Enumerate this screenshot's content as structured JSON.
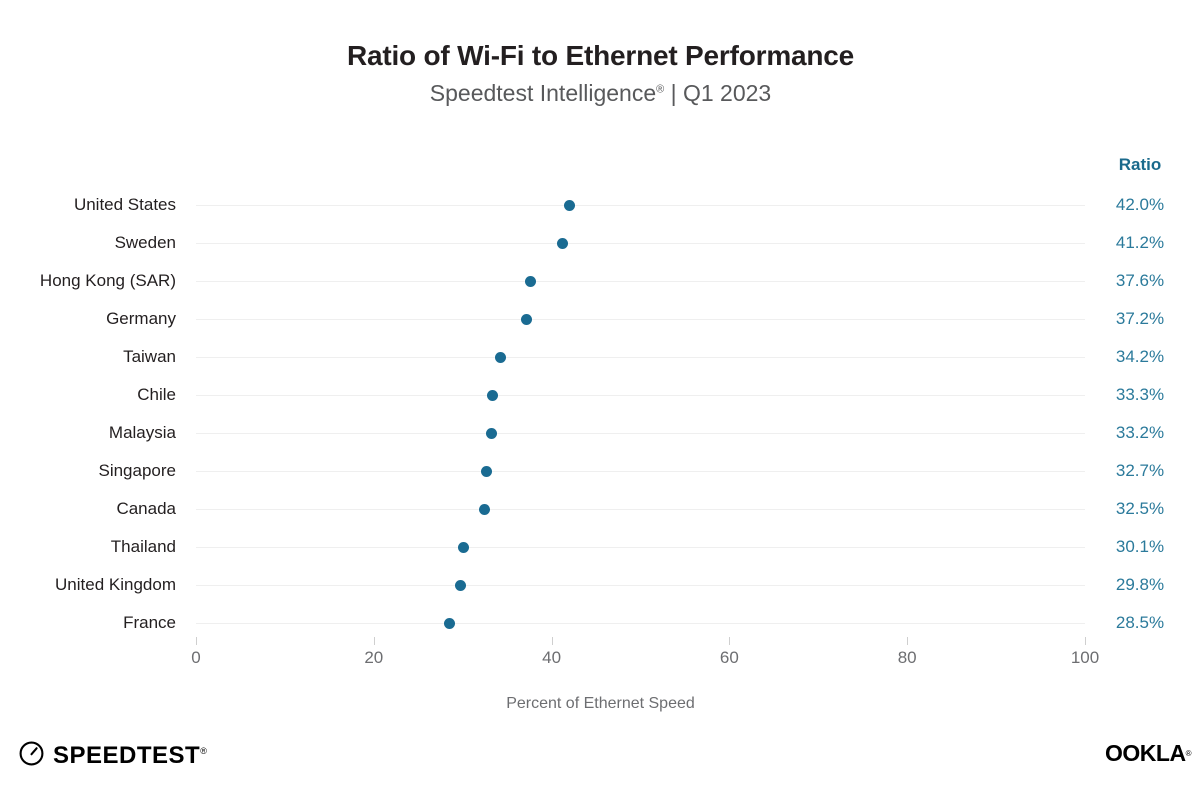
{
  "chart_data": {
    "type": "scatter",
    "title": "Ratio of Wi-Fi to Ethernet Performance",
    "subtitle_main": "Speedtest Intelligence",
    "subtitle_reg": "®",
    "subtitle_tail": " | Q1 2023",
    "xlabel": "Percent of Ethernet Speed",
    "ylabel": "",
    "xlim": [
      0,
      100
    ],
    "xticks": [
      0,
      20,
      40,
      60,
      80,
      100
    ],
    "xtick_labels": [
      "0",
      "20",
      "40",
      "60",
      "80",
      "100"
    ],
    "grid": true,
    "grid_axis": "y",
    "legend": false,
    "value_column_header": "Ratio",
    "dot_color": "#1a6b92",
    "value_text_color": "#2b7a9b",
    "gridline_color": "#efefef",
    "categories": [
      "United States",
      "Sweden",
      "Hong Kong (SAR)",
      "Germany",
      "Taiwan",
      "Chile",
      "Malaysia",
      "Singapore",
      "Canada",
      "Thailand",
      "United Kingdom",
      "France"
    ],
    "values": [
      42.0,
      41.2,
      37.6,
      37.2,
      34.2,
      33.3,
      33.2,
      32.7,
      32.5,
      30.1,
      29.8,
      28.5
    ],
    "value_labels": [
      "42.0%",
      "41.2%",
      "37.6%",
      "37.2%",
      "34.2%",
      "33.3%",
      "33.2%",
      "32.7%",
      "32.5%",
      "30.1%",
      "29.8%",
      "28.5%"
    ]
  },
  "footer": {
    "speedtest_name": "SPEEDTEST",
    "speedtest_tm": "®",
    "ookla_name_a": "OO",
    "ookla_name_b": "K",
    "ookla_name_c": "LA",
    "ookla_tm": "®"
  }
}
